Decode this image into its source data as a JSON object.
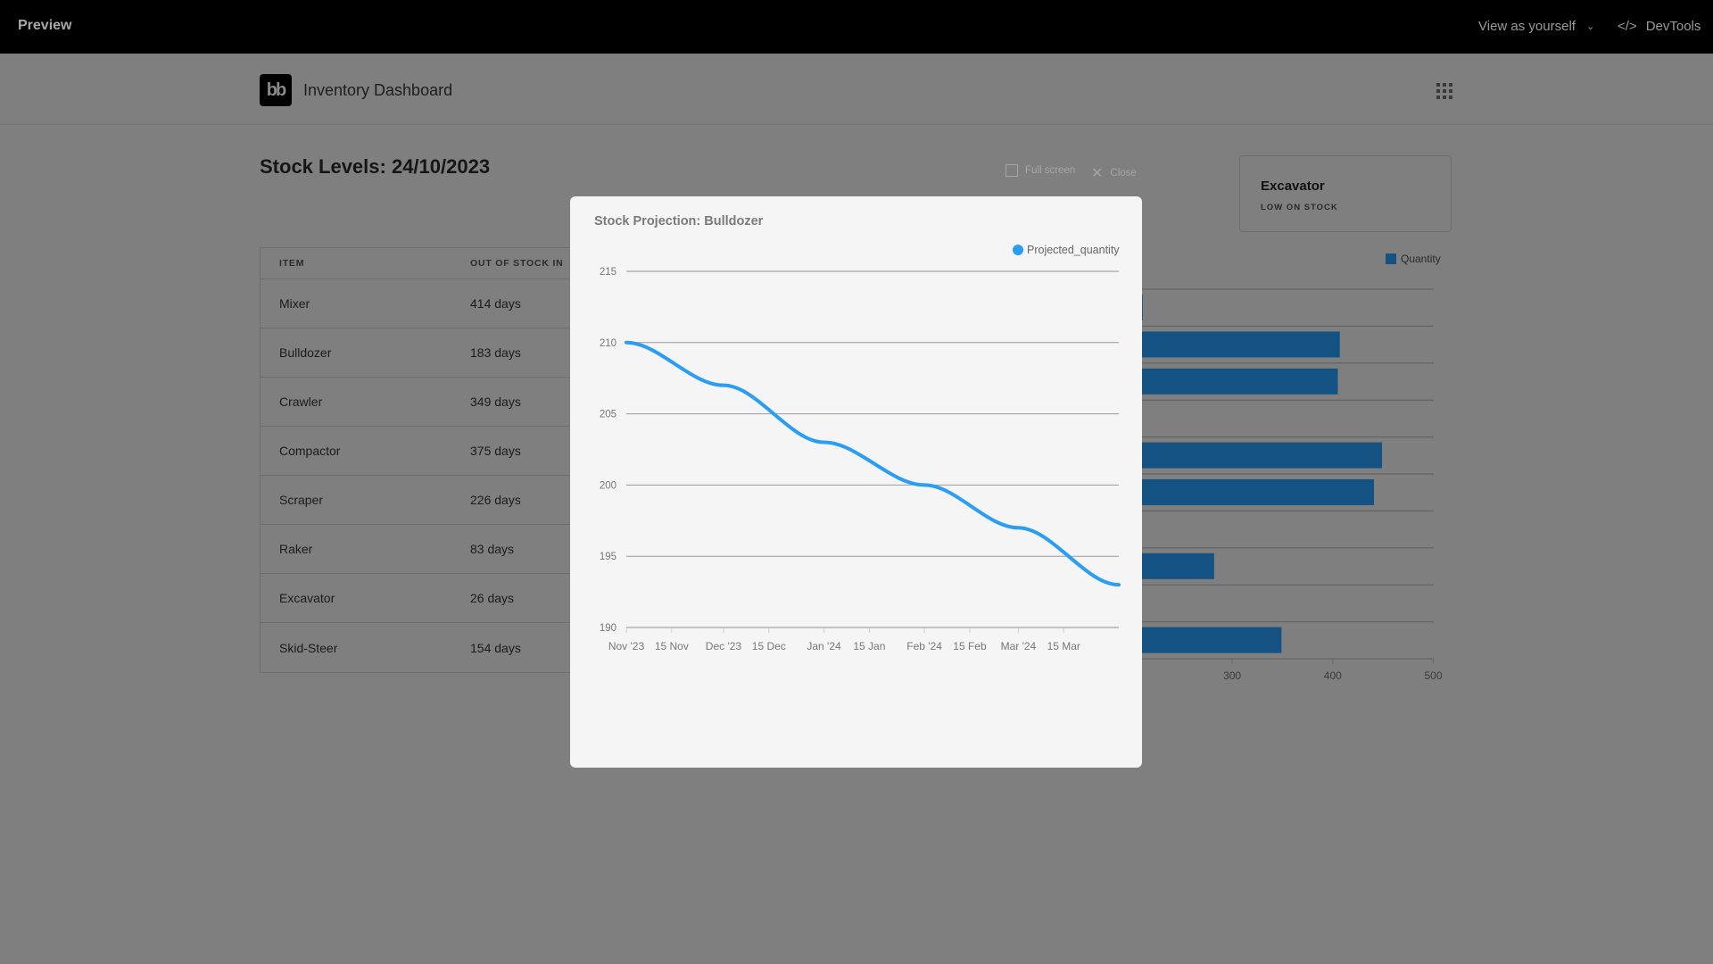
{
  "topbar": {
    "title": "Preview",
    "view_as": "View as yourself",
    "devtools": "DevTools"
  },
  "header": {
    "logo": "bb",
    "title": "Inventory Dashboard"
  },
  "page": {
    "title": "Stock Levels: 24/10/2023"
  },
  "table": {
    "headers": [
      "ITEM",
      "OUT OF STOCK IN"
    ],
    "rows": [
      [
        "Mixer",
        "414 days"
      ],
      [
        "Bulldozer",
        "183 days"
      ],
      [
        "Crawler",
        "349 days"
      ],
      [
        "Compactor",
        "375 days"
      ],
      [
        "Scraper",
        "226 days"
      ],
      [
        "Raker",
        "83 days"
      ],
      [
        "Excavator",
        "26 days"
      ],
      [
        "Skid-Steer",
        "154 days"
      ]
    ]
  },
  "modal_actions": {
    "fullscreen": "Full screen",
    "close": "Close"
  },
  "card": {
    "title": "Excavator",
    "subtitle": "LOW ON STOCK"
  },
  "bar_chart_visible": {
    "legend": "Quantity",
    "color": "#135283",
    "x_ticks": [
      "300",
      "400",
      "500"
    ],
    "values": [
      211,
      407,
      405,
      null,
      449,
      441,
      null,
      282,
      null,
      349
    ]
  },
  "chart_data": {
    "type": "line",
    "title": "Stock Projection: Bulldozer",
    "series": [
      {
        "name": "Projected_quantity",
        "color": "#2a9df4",
        "x": [
          "2023-11-01",
          "2023-12-01",
          "2024-01-01",
          "2024-02-01",
          "2024-03-01",
          "2024-04-01"
        ],
        "values": [
          210,
          207,
          203,
          200,
          197,
          193
        ]
      }
    ],
    "x_ticks": [
      "Nov '23",
      "15 Nov",
      "Dec '23",
      "15 Dec",
      "Jan '24",
      "15 Jan",
      "Feb '24",
      "15 Feb",
      "Mar '24",
      "15 Mar"
    ],
    "x_tick_dates": [
      "2023-11-01",
      "2023-11-15",
      "2023-12-01",
      "2023-12-15",
      "2024-01-01",
      "2024-01-15",
      "2024-02-01",
      "2024-02-15",
      "2024-03-01",
      "2024-03-15"
    ],
    "y_ticks": [
      190,
      195,
      200,
      205,
      210,
      215
    ],
    "ylim": [
      190,
      215
    ],
    "xlim": [
      "2023-11-01",
      "2024-04-01"
    ],
    "grid": true,
    "legend": "top-right"
  }
}
